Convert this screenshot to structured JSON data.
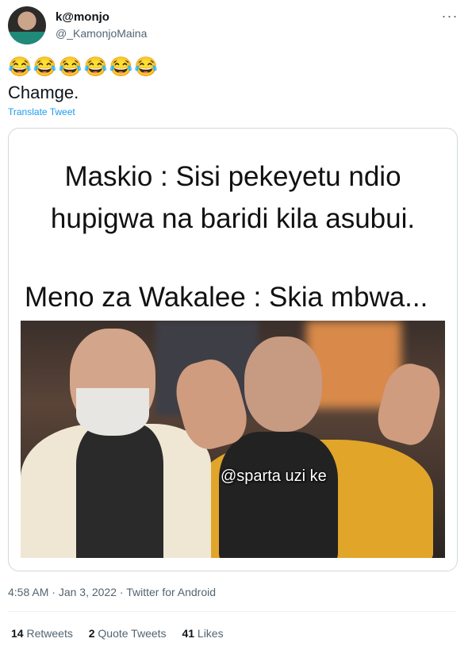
{
  "author": {
    "display_name": "k@monjo",
    "handle": "@_KamonjoMaina"
  },
  "more_icon": "···",
  "tweet": {
    "emojis": "😂😂😂😂😂😂",
    "text": "Chamge.",
    "translate_label": "Translate Tweet"
  },
  "meme": {
    "line1": "Maskio : Sisi pekeyetu ndio",
    "line2": "hupigwa na baridi kila asubui.",
    "line3": "Meno za Wakalee : Skia mbwa...",
    "watermark": "@sparta uzi ke"
  },
  "meta": {
    "time": "4:58 AM",
    "sep1": " · ",
    "date": "Jan 3, 2022",
    "sep2": " · ",
    "source": "Twitter for Android"
  },
  "stats": {
    "retweets_count": "14",
    "retweets_label": "Retweets",
    "quotes_count": "2",
    "quotes_label": "Quote Tweets",
    "likes_count": "41",
    "likes_label": "Likes"
  }
}
